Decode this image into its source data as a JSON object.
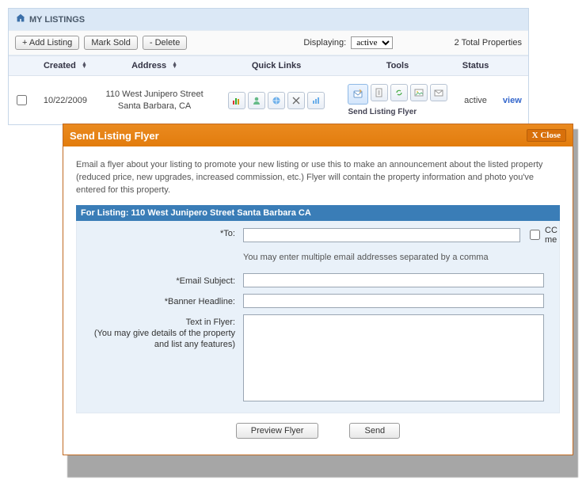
{
  "listings_panel": {
    "title": "MY LISTINGS",
    "buttons": {
      "add": "+ Add Listing",
      "mark_sold": "Mark Sold",
      "delete": "- Delete"
    },
    "displaying": {
      "label": "Displaying:",
      "selected": "active"
    },
    "total_properties": "2 Total Properties",
    "columns": {
      "created": "Created",
      "address": "Address",
      "quick_links": "Quick Links",
      "tools": "Tools",
      "status": "Status"
    },
    "row": {
      "created": "10/22/2009",
      "address_line1": "110 West Junipero Street",
      "address_line2": "Santa Barbara, CA",
      "tool_caption": "Send Listing Flyer",
      "status": "active",
      "view": "view"
    }
  },
  "modal": {
    "title": "Send Listing Flyer",
    "close": "X Close",
    "intro": "Email a flyer about your listing to promote your new listing or use this to make an announcement about the listed property (reduced price, new upgrades, increased commission, etc.) Flyer will contain the property information and photo you've entered for this property.",
    "for_listing": "For Listing: 110 West Junipero Street Santa Barbara CA",
    "labels": {
      "to": "*To:",
      "cc_me": "CC me",
      "to_hint": "You may enter multiple email addresses separated by a comma",
      "subject": "*Email Subject:",
      "banner": "*Banner Headline:",
      "text_in_flyer": "Text in Flyer:",
      "text_in_flyer_hint": "(You may give details of the property and list any features)"
    },
    "buttons": {
      "preview": "Preview Flyer",
      "send": "Send"
    }
  }
}
